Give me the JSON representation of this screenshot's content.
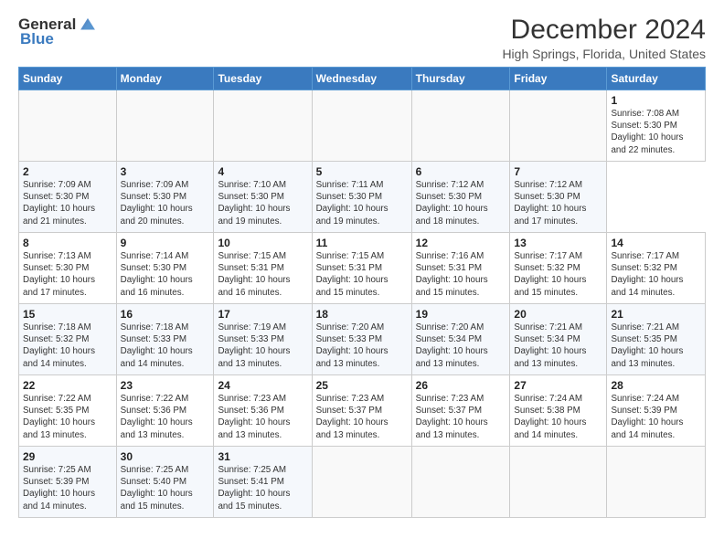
{
  "header": {
    "logo_general": "General",
    "logo_blue": "Blue",
    "title": "December 2024",
    "subtitle": "High Springs, Florida, United States"
  },
  "calendar": {
    "headers": [
      "Sunday",
      "Monday",
      "Tuesday",
      "Wednesday",
      "Thursday",
      "Friday",
      "Saturday"
    ],
    "weeks": [
      [
        {
          "day": "",
          "info": ""
        },
        {
          "day": "",
          "info": ""
        },
        {
          "day": "",
          "info": ""
        },
        {
          "day": "",
          "info": ""
        },
        {
          "day": "",
          "info": ""
        },
        {
          "day": "",
          "info": ""
        },
        {
          "day": "1",
          "info": "Sunrise: 7:08 AM\nSunset: 5:30 PM\nDaylight: 10 hours\nand 22 minutes."
        }
      ],
      [
        {
          "day": "2",
          "info": "Sunrise: 7:09 AM\nSunset: 5:30 PM\nDaylight: 10 hours\nand 21 minutes."
        },
        {
          "day": "3",
          "info": "Sunrise: 7:09 AM\nSunset: 5:30 PM\nDaylight: 10 hours\nand 20 minutes."
        },
        {
          "day": "4",
          "info": "Sunrise: 7:10 AM\nSunset: 5:30 PM\nDaylight: 10 hours\nand 19 minutes."
        },
        {
          "day": "5",
          "info": "Sunrise: 7:11 AM\nSunset: 5:30 PM\nDaylight: 10 hours\nand 19 minutes."
        },
        {
          "day": "6",
          "info": "Sunrise: 7:12 AM\nSunset: 5:30 PM\nDaylight: 10 hours\nand 18 minutes."
        },
        {
          "day": "7",
          "info": "Sunrise: 7:12 AM\nSunset: 5:30 PM\nDaylight: 10 hours\nand 17 minutes."
        }
      ],
      [
        {
          "day": "8",
          "info": "Sunrise: 7:13 AM\nSunset: 5:30 PM\nDaylight: 10 hours\nand 17 minutes."
        },
        {
          "day": "9",
          "info": "Sunrise: 7:14 AM\nSunset: 5:30 PM\nDaylight: 10 hours\nand 16 minutes."
        },
        {
          "day": "10",
          "info": "Sunrise: 7:15 AM\nSunset: 5:31 PM\nDaylight: 10 hours\nand 16 minutes."
        },
        {
          "day": "11",
          "info": "Sunrise: 7:15 AM\nSunset: 5:31 PM\nDaylight: 10 hours\nand 15 minutes."
        },
        {
          "day": "12",
          "info": "Sunrise: 7:16 AM\nSunset: 5:31 PM\nDaylight: 10 hours\nand 15 minutes."
        },
        {
          "day": "13",
          "info": "Sunrise: 7:17 AM\nSunset: 5:32 PM\nDaylight: 10 hours\nand 15 minutes."
        },
        {
          "day": "14",
          "info": "Sunrise: 7:17 AM\nSunset: 5:32 PM\nDaylight: 10 hours\nand 14 minutes."
        }
      ],
      [
        {
          "day": "15",
          "info": "Sunrise: 7:18 AM\nSunset: 5:32 PM\nDaylight: 10 hours\nand 14 minutes."
        },
        {
          "day": "16",
          "info": "Sunrise: 7:18 AM\nSunset: 5:33 PM\nDaylight: 10 hours\nand 14 minutes."
        },
        {
          "day": "17",
          "info": "Sunrise: 7:19 AM\nSunset: 5:33 PM\nDaylight: 10 hours\nand 13 minutes."
        },
        {
          "day": "18",
          "info": "Sunrise: 7:20 AM\nSunset: 5:33 PM\nDaylight: 10 hours\nand 13 minutes."
        },
        {
          "day": "19",
          "info": "Sunrise: 7:20 AM\nSunset: 5:34 PM\nDaylight: 10 hours\nand 13 minutes."
        },
        {
          "day": "20",
          "info": "Sunrise: 7:21 AM\nSunset: 5:34 PM\nDaylight: 10 hours\nand 13 minutes."
        },
        {
          "day": "21",
          "info": "Sunrise: 7:21 AM\nSunset: 5:35 PM\nDaylight: 10 hours\nand 13 minutes."
        }
      ],
      [
        {
          "day": "22",
          "info": "Sunrise: 7:22 AM\nSunset: 5:35 PM\nDaylight: 10 hours\nand 13 minutes."
        },
        {
          "day": "23",
          "info": "Sunrise: 7:22 AM\nSunset: 5:36 PM\nDaylight: 10 hours\nand 13 minutes."
        },
        {
          "day": "24",
          "info": "Sunrise: 7:23 AM\nSunset: 5:36 PM\nDaylight: 10 hours\nand 13 minutes."
        },
        {
          "day": "25",
          "info": "Sunrise: 7:23 AM\nSunset: 5:37 PM\nDaylight: 10 hours\nand 13 minutes."
        },
        {
          "day": "26",
          "info": "Sunrise: 7:23 AM\nSunset: 5:37 PM\nDaylight: 10 hours\nand 13 minutes."
        },
        {
          "day": "27",
          "info": "Sunrise: 7:24 AM\nSunset: 5:38 PM\nDaylight: 10 hours\nand 14 minutes."
        },
        {
          "day": "28",
          "info": "Sunrise: 7:24 AM\nSunset: 5:39 PM\nDaylight: 10 hours\nand 14 minutes."
        }
      ],
      [
        {
          "day": "29",
          "info": "Sunrise: 7:25 AM\nSunset: 5:39 PM\nDaylight: 10 hours\nand 14 minutes."
        },
        {
          "day": "30",
          "info": "Sunrise: 7:25 AM\nSunset: 5:40 PM\nDaylight: 10 hours\nand 15 minutes."
        },
        {
          "day": "31",
          "info": "Sunrise: 7:25 AM\nSunset: 5:41 PM\nDaylight: 10 hours\nand 15 minutes."
        },
        {
          "day": "",
          "info": ""
        },
        {
          "day": "",
          "info": ""
        },
        {
          "day": "",
          "info": ""
        },
        {
          "day": "",
          "info": ""
        }
      ]
    ]
  }
}
